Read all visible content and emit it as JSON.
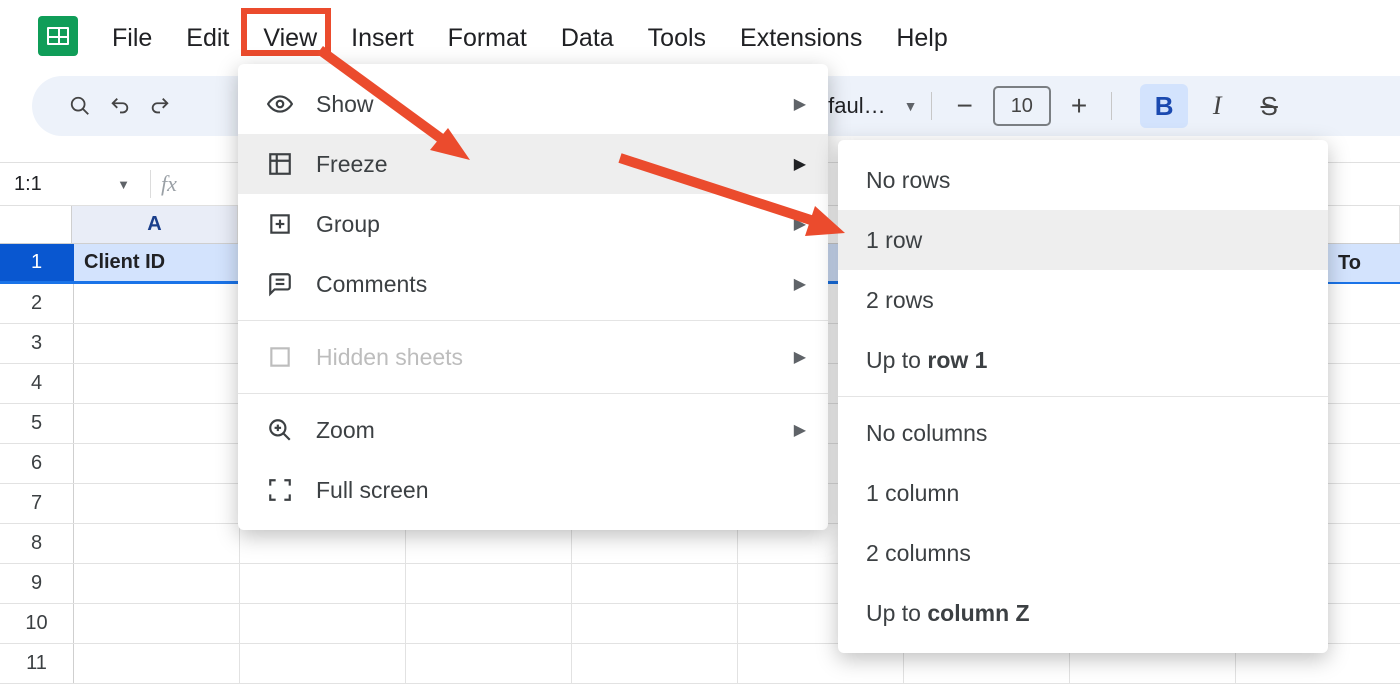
{
  "menubar": {
    "file": "File",
    "edit": "Edit",
    "view": "View",
    "insert": "Insert",
    "format": "Format",
    "data": "Data",
    "tools": "Tools",
    "extensions": "Extensions",
    "help": "Help"
  },
  "toolbar": {
    "font_label": "Defaul…",
    "font_size": "10"
  },
  "namebox": {
    "value": "1:1"
  },
  "grid": {
    "col_a": "A",
    "cell_a1": "Client ID",
    "right_header": "To",
    "row_labels": [
      "1",
      "2",
      "3",
      "4",
      "5",
      "6",
      "7",
      "8",
      "9",
      "10",
      "11"
    ]
  },
  "view_menu": {
    "show": "Show",
    "freeze": "Freeze",
    "group": "Group",
    "comments": "Comments",
    "hidden_sheets": "Hidden sheets",
    "zoom": "Zoom",
    "full_screen": "Full screen"
  },
  "freeze_menu": {
    "no_rows": "No rows",
    "one_row": "1 row",
    "two_rows": "2 rows",
    "up_to_row_prefix": "Up to ",
    "up_to_row_bold": "row 1",
    "no_cols": "No columns",
    "one_col": "1 column",
    "two_cols": "2 columns",
    "up_to_col_prefix": "Up to ",
    "up_to_col_bold": "column Z"
  },
  "annotation": {
    "highlight_color": "#eb4b2d"
  }
}
